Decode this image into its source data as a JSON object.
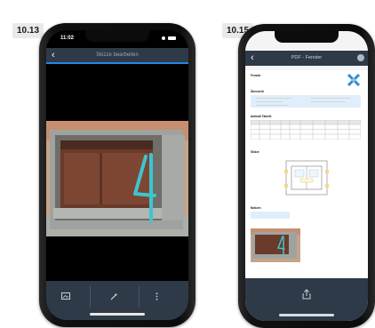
{
  "figure_labels": {
    "left": "10.13",
    "right": "10.15"
  },
  "colors": {
    "nav_bar": "#2f3a48",
    "accent": "#1e88e5",
    "sketch": "#3cc6d0",
    "info_box": "#dfeefa"
  },
  "left_phone": {
    "status_time": "11:02",
    "title": "Skizze bearbeiten",
    "back_icon": "chevron-left-icon",
    "toolbar": {
      "icons": [
        "image-icon",
        "magic-wand-icon",
        "more-vertical-icon"
      ]
    }
  },
  "right_phone": {
    "title": "PDF - Fenster",
    "back_icon": "chevron-left-icon",
    "share_icon": "share-icon",
    "document": {
      "heading": "Fenster",
      "section_1": "Übersicht",
      "section_2": "Aufmaß Tabelle",
      "section_3": "Skizze",
      "section_4": "Notizen"
    }
  }
}
